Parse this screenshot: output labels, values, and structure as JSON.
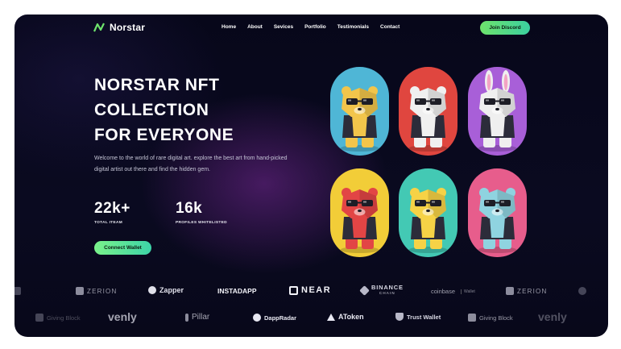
{
  "nav": {
    "logo_text": "Norstar",
    "links": [
      "Home",
      "About",
      "Sevices",
      "Portfolio",
      "Testimonials",
      "Contact"
    ],
    "cta": "Join Discord",
    "logo_color": "#6ee36c"
  },
  "hero": {
    "title_lines": [
      "NORSTAR NFT",
      "COLLECTION",
      "FOR EVERYONE"
    ],
    "description": "Welcome to the world of rare digital art. explore the best art from hand-picked digital artist out there and find the hidden gem.",
    "stats": [
      {
        "value": "22k+",
        "label": "TOTAL ITEAM"
      },
      {
        "value": "16k",
        "label": "PROFILES WHITELISTED"
      }
    ],
    "cta": "Connect Wallet"
  },
  "cards": [
    {
      "bg": "#4fb6d6",
      "character": "bear",
      "body": "#f2c54b"
    },
    {
      "bg": "#e0463f",
      "character": "bear",
      "body": "#f0f0f0"
    },
    {
      "bg": "#a85fd8",
      "character": "rabbit",
      "body": "#efefef"
    },
    {
      "bg": "#f2cd38",
      "character": "bear",
      "body": "#e24545"
    },
    {
      "bg": "#43c9b4",
      "character": "bear",
      "body": "#f6d246"
    },
    {
      "bg": "#e75d8c",
      "character": "bear",
      "body": "#8fd3e0"
    }
  ],
  "partners_row1": [
    "ZERION",
    "Zapper",
    "INSTADAPP",
    "NEAR",
    "BINANCE",
    "CHAIN",
    "coinbase",
    "Wallet",
    "ZERION"
  ],
  "partners_row2": [
    "Giving Block",
    "venly",
    "Pillar",
    "DappRadar",
    "AToken",
    "Trust Wallet",
    "Giving Block",
    "venly"
  ],
  "colors": {
    "accent": "#6ee36c",
    "background": "#0a0a20"
  }
}
